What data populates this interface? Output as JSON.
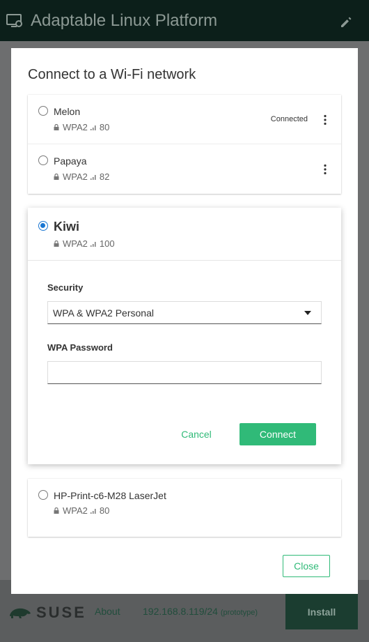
{
  "app": {
    "title": "Adaptable Linux Platform",
    "logo_icon": "monitor-settings-icon",
    "edit_icon": "pencil-icon"
  },
  "footer": {
    "brand": "SUSE",
    "about": "About",
    "ip": "192.168.8.119/24",
    "ip_note": "(prototype)",
    "install": "Install"
  },
  "dialog": {
    "title": "Connect to a Wi-Fi network",
    "close_label": "Close",
    "networks_top": [
      {
        "name": "Melon",
        "security": "WPA2",
        "signal": "80",
        "status": "Connected",
        "selected": false
      },
      {
        "name": "Papaya",
        "security": "WPA2",
        "signal": "82",
        "status": "",
        "selected": false
      }
    ],
    "expanded": {
      "name": "Kiwi",
      "security": "WPA2",
      "signal": "100",
      "selected": true,
      "security_label": "Security",
      "security_value": "WPA & WPA2 Personal",
      "password_label": "WPA Password",
      "password_value": "",
      "cancel_label": "Cancel",
      "connect_label": "Connect"
    },
    "networks_bottom": [
      {
        "name": "HP-Print-c6-M28 LaserJet",
        "security": "WPA2",
        "signal": "80",
        "status": "",
        "selected": false
      }
    ]
  },
  "colors": {
    "accent": "#30ba78",
    "radio_selected": "#1976d2",
    "header_bg": "#0c1f1a"
  }
}
